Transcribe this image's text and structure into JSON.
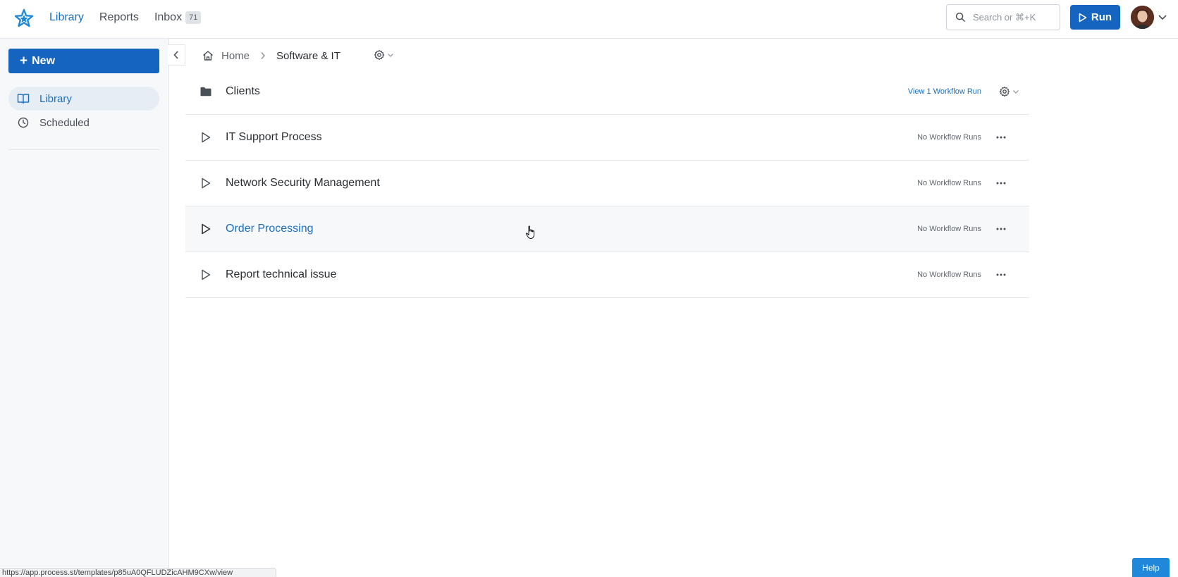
{
  "nav": {
    "items": [
      {
        "label": "Library",
        "active": true
      },
      {
        "label": "Reports",
        "active": false
      },
      {
        "label": "Inbox",
        "active": false
      }
    ],
    "inbox_badge": "71"
  },
  "search": {
    "placeholder": "Search or ⌘+K"
  },
  "run_button": {
    "label": "Run"
  },
  "sidebar": {
    "new_label": "New",
    "items": [
      {
        "label": "Library",
        "icon": "book-icon",
        "active": true
      },
      {
        "label": "Scheduled",
        "icon": "clock-icon",
        "active": false
      }
    ]
  },
  "breadcrumb": {
    "home": "Home",
    "current": "Software & IT"
  },
  "rows": [
    {
      "type": "folder",
      "title": "Clients",
      "runs": "View 1 Workflow Run"
    },
    {
      "type": "workflow",
      "title": "IT Support Process",
      "runs": "No Workflow Runs"
    },
    {
      "type": "workflow",
      "title": "Network Security Management",
      "runs": "No Workflow Runs"
    },
    {
      "type": "workflow",
      "title": "Order Processing",
      "runs": "No Workflow Runs"
    },
    {
      "type": "workflow",
      "title": "Report technical issue",
      "runs": "No Workflow Runs"
    }
  ],
  "status_url": "https://app.process.st/templates/p85uA0QFLUDZicAHM9CXw/view",
  "help_label": "Help",
  "colors": {
    "accent": "#1565c0",
    "link": "#1a6fbf",
    "sidebar_bg": "#f7f8fa"
  }
}
